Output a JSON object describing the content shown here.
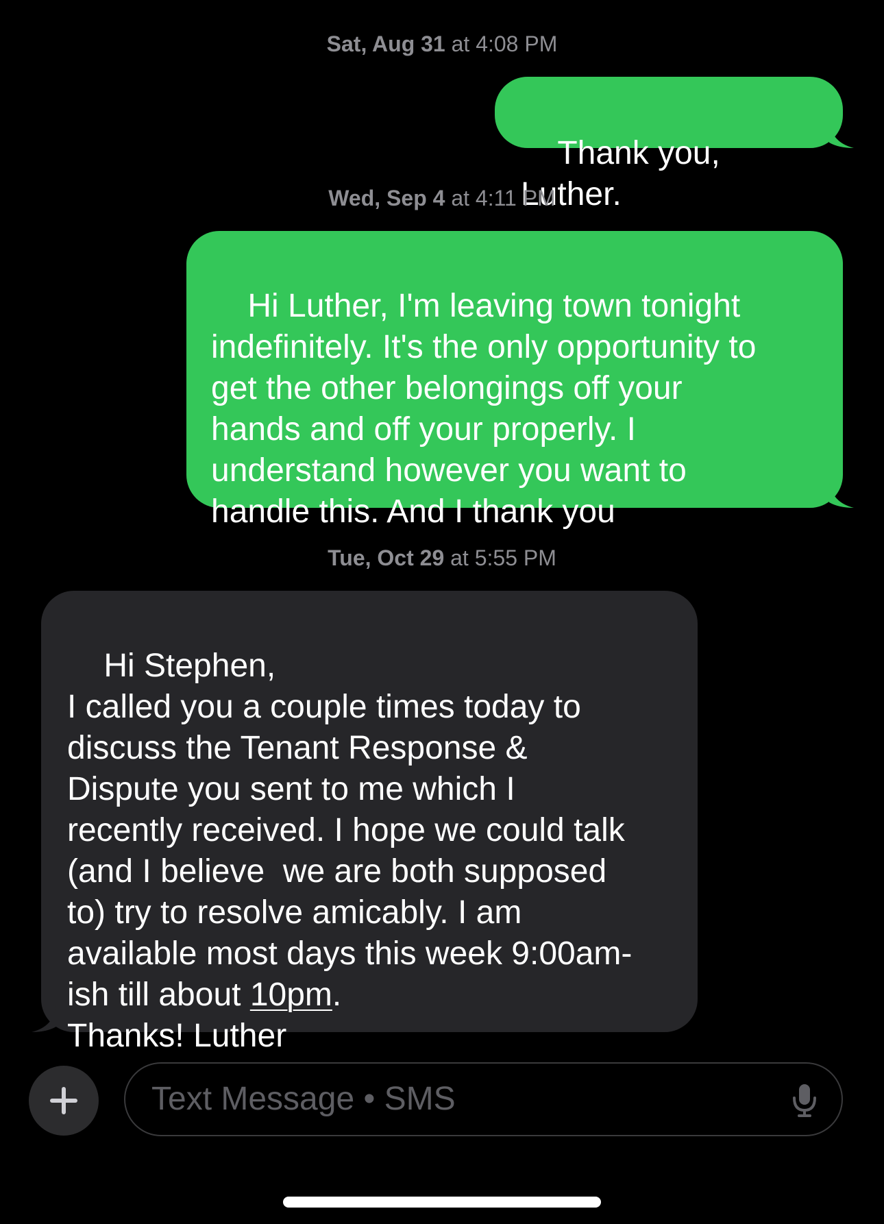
{
  "conversation": {
    "stamps": [
      {
        "day": "Sat, Aug 31",
        "time": "at 4:08 PM"
      },
      {
        "day": "Wed, Sep 4",
        "time": "at 4:11 PM"
      },
      {
        "day": "Tue, Oct 29",
        "time": "at 5:55 PM"
      }
    ],
    "messages": [
      {
        "direction": "outgoing",
        "text": "Thank you, Luther."
      },
      {
        "direction": "outgoing",
        "text": "Hi Luther, I'm leaving town tonight\nindefinitely. It's the only opportunity to\nget the other belongings off your\nhands and off your properly. I\nunderstand however you want to\nhandle this. And I thank you"
      },
      {
        "direction": "incoming",
        "text_before_link": "Hi Stephen,\nI called you a couple times today to\ndiscuss the Tenant Response &\nDispute you sent to me which I\nrecently received. I hope we could talk\n(and I believe  we are both supposed\nto) try to resolve amicably. I am\navailable most days this week 9:00am-\nish till about ",
        "link_text": "10pm",
        "text_after_link": ".\nThanks! Luther"
      }
    ]
  },
  "composer": {
    "plus_icon": "plus-icon",
    "placeholder": "Text Message • SMS",
    "mic_icon": "microphone-icon"
  },
  "colors": {
    "background": "#000000",
    "outgoing_bubble": "#34c759",
    "incoming_bubble": "#262629",
    "timestamp": "#8e8e93",
    "placeholder": "#5e5e63"
  }
}
